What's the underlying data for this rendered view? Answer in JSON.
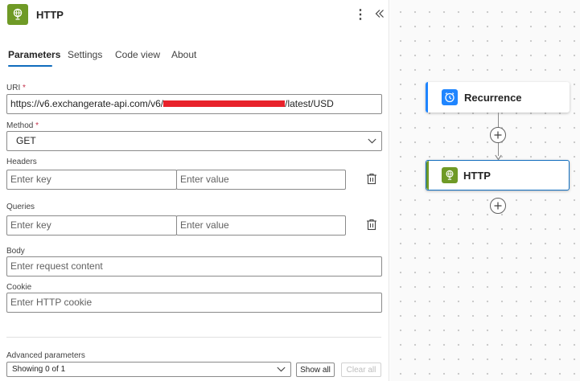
{
  "header": {
    "title": "HTTP",
    "more_icon": "more-vertical-icon",
    "collapse_icon": "double-chevron-left-icon",
    "app_icon": "globe-icon",
    "brand_color": "#6f9a26"
  },
  "tabs": [
    {
      "label": "Parameters",
      "active": true
    },
    {
      "label": "Settings",
      "active": false
    },
    {
      "label": "Code view",
      "active": false
    },
    {
      "label": "About",
      "active": false
    }
  ],
  "uri": {
    "label": "URI",
    "required_mark": "*",
    "value_prefix": "https://v6.exchangerate-api.com/v6/",
    "value_suffix": "/latest/USD"
  },
  "method": {
    "label": "Method",
    "required_mark": "*",
    "value": "GET"
  },
  "headers": {
    "label": "Headers",
    "key_placeholder": "Enter key",
    "value_placeholder": "Enter value"
  },
  "queries": {
    "label": "Queries",
    "key_placeholder": "Enter key",
    "value_placeholder": "Enter value"
  },
  "body": {
    "label": "Body",
    "placeholder": "Enter request content"
  },
  "cookie": {
    "label": "Cookie",
    "placeholder": "Enter HTTP cookie"
  },
  "advanced": {
    "label": "Advanced parameters",
    "value": "Showing 0 of 1",
    "show_all_label": "Show all",
    "clear_all_label": "Clear all"
  },
  "canvas": {
    "nodes": [
      {
        "title": "Recurrence",
        "icon": "alarm-clock-icon",
        "color": "#1f85ff"
      },
      {
        "title": "HTTP",
        "icon": "globe-icon",
        "color": "#6f9a26"
      }
    ],
    "selected_accent": "#0f6cbd"
  }
}
